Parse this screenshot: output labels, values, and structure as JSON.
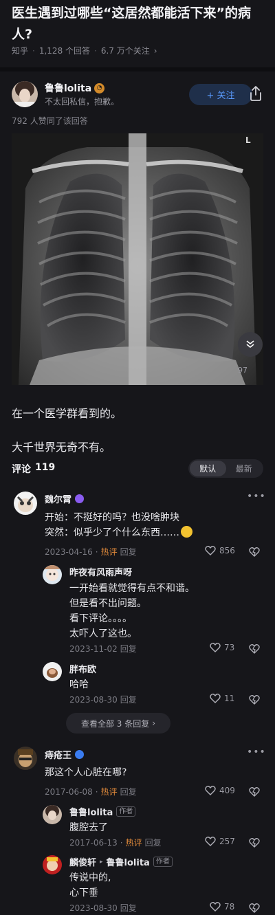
{
  "question": {
    "title": "医生遇到过哪些“这居然都能活下来”的病人?",
    "source": "知乎",
    "answers": "1,128 个回答",
    "followers": "6.7 万个关注",
    "more_icon": "chevron-right-icon"
  },
  "author": {
    "name": "鲁鲁lolita",
    "subtitle": "不太回私信，抱歉。",
    "follow_label": "+ 关注",
    "likes_line": "792 人赞同了该回答"
  },
  "image": {
    "corner_mark": "L",
    "float_count": "97"
  },
  "answer": {
    "paragraphs": [
      "在一个医学群看到的。",
      "大千世界无奇不有。"
    ]
  },
  "comments_section": {
    "label": "评论",
    "count": "119",
    "sort_options": [
      "默认",
      "最新"
    ]
  },
  "comments": [
    {
      "name": "魏尔霄",
      "lines": [
        "开始：不挺好的吗？也没啥肿块",
        "突然：似乎少了个什么东西……"
      ],
      "date": "2023-04-16",
      "hot": "热评",
      "reply": "回复",
      "likes": "856"
    },
    {
      "name": "昨夜有风雨声呀",
      "lines": [
        "一开始看就觉得有点不和谐。",
        "但是看不出问题。",
        "看下评论。。。。",
        "太吓人了这也。"
      ],
      "date": "2023-11-02",
      "reply": "回复",
      "likes": "73"
    },
    {
      "name": "胖布欧",
      "lines": [
        "哈哈"
      ],
      "date": "2023-08-30",
      "reply": "回复",
      "likes": "11"
    },
    {
      "name": "痔疮王",
      "lines": [
        "那这个人心脏在哪?"
      ],
      "date": "2017-06-08",
      "hot": "热评",
      "reply": "回复",
      "likes": "409"
    },
    {
      "name": "鲁鲁lolita",
      "tag": "作者",
      "lines": [
        "腹腔去了"
      ],
      "date": "2017-06-13",
      "hot": "热评",
      "reply": "回复",
      "likes": "257"
    },
    {
      "name": "麟俊轩",
      "reply_to": "鲁鲁lolita",
      "tag": "作者",
      "lines": [
        "传说中的,",
        "心下垂"
      ],
      "date": "2023-08-30",
      "reply": "回复",
      "likes": "78"
    }
  ],
  "view_all": "查看全部 3 条回复",
  "colors": {
    "background": "#16161a",
    "accent": "#5a9bff",
    "hot": "#e0893a"
  }
}
